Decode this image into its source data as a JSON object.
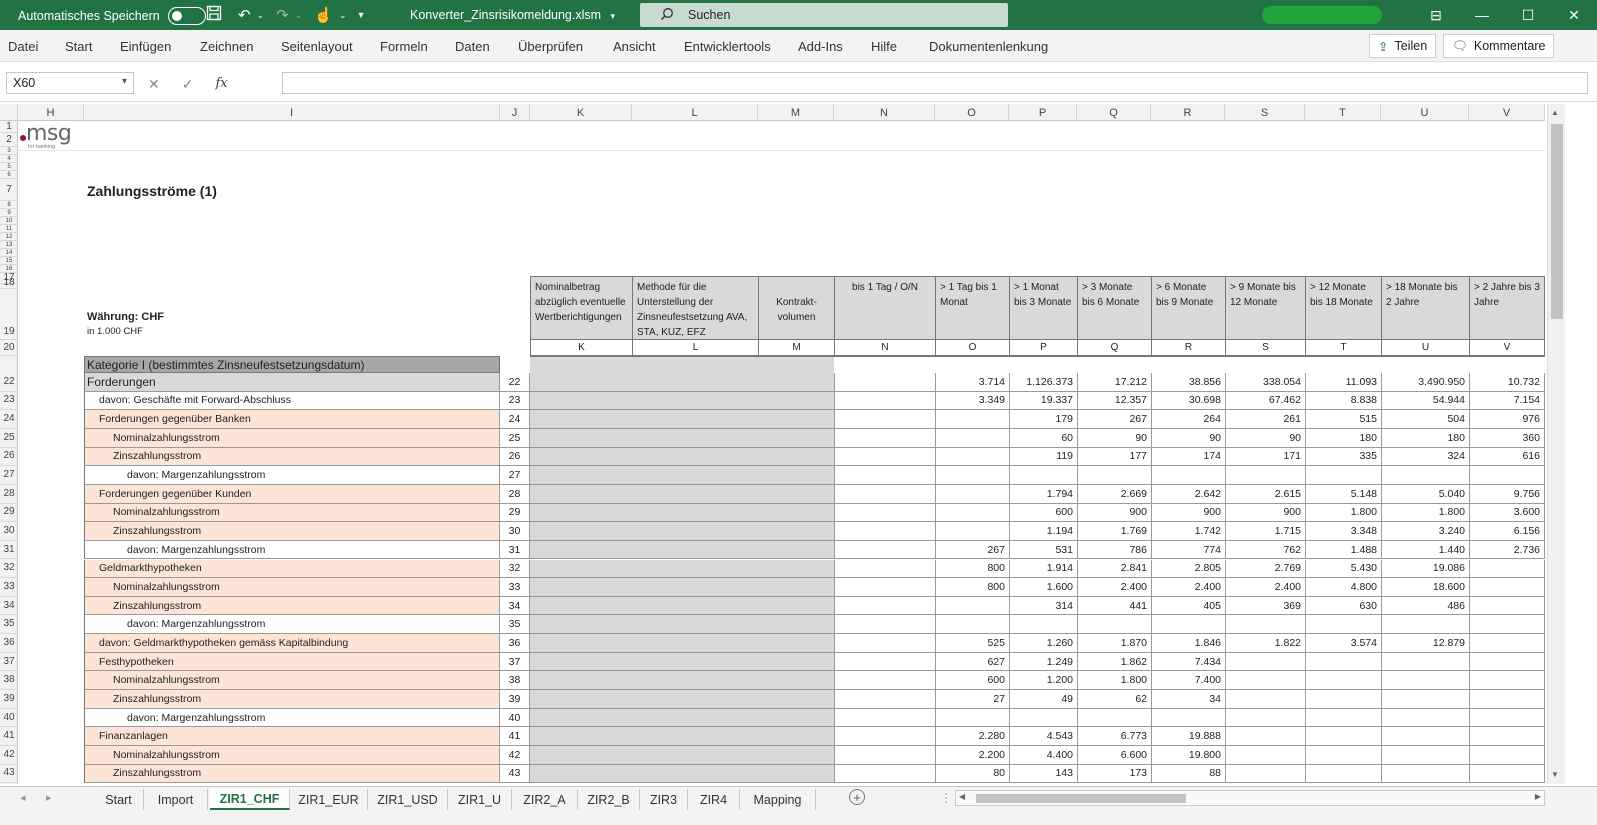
{
  "titlebar": {
    "autosave_label": "Automatisches Speichern",
    "filename": "Konverter_Zinsrisikomeldung.xlsm",
    "search_placeholder": "Suchen"
  },
  "ribbon": {
    "tabs": [
      "Datei",
      "Start",
      "Einfügen",
      "Zeichnen",
      "Seitenlayout",
      "Formeln",
      "Daten",
      "Überprüfen",
      "Ansicht",
      "Entwicklertools",
      "Add-Ins",
      "Hilfe",
      "Dokumentenlenkung"
    ],
    "share_label": "Teilen",
    "comments_label": "Kommentare"
  },
  "formula_bar": {
    "name_box": "X60",
    "fx": "fx",
    "content": ""
  },
  "columns": [
    "H",
    "I",
    "J",
    "K",
    "L",
    "M",
    "N",
    "O",
    "P",
    "Q",
    "R",
    "S",
    "T",
    "U",
    "V"
  ],
  "rows_top": [
    "1",
    "2",
    "3",
    "4",
    "5",
    "6",
    "7",
    "8",
    "9",
    "10",
    "11",
    "12",
    "13",
    "14",
    "15",
    "16",
    "17",
    "18",
    "19",
    "20"
  ],
  "sheet": {
    "logo_text": "msg",
    "logo_sub": "for banking",
    "title": "Zahlungsströme (1)",
    "currency": "Währung: CHF",
    "unit": "in 1.000 CHF",
    "headers": [
      "Nominalbetrag abzüglich eventuelle Wertberichtigungen",
      "Methode für die Unterstellung der Zinsneufestsetzung AVA, STA, KUZ, EFZ",
      "Kontrakt-volumen",
      "bis 1 Tag / O/N",
      "> 1 Tag bis 1 Monat",
      "> 1 Monat bis 3 Monate",
      "> 3 Monate bis 6 Monate",
      "> 6 Monate bis 9 Monate",
      "> 9 Monate bis 12 Monate",
      "> 12 Monate bis 18 Monate",
      "> 18 Monate bis 2 Jahre",
      "> 2 Jahre bis 3 Jahre"
    ],
    "header_letters": [
      "K",
      "L",
      "M",
      "N",
      "O",
      "P",
      "Q",
      "R",
      "S",
      "T",
      "U",
      "V"
    ],
    "category_label": "Kategorie I (bestimmtes Zinsneufestsetzungsdatum)",
    "rows": [
      {
        "r": "22",
        "label": "Forderungen",
        "nr": "22",
        "O": "3.714",
        "P": "1.126.373",
        "Q": "17.212",
        "R": "38.856",
        "S": "338.054",
        "T": "11.093",
        "U": "3.490.950",
        "V": "10.732"
      },
      {
        "r": "23",
        "label": "davon: Geschäfte mit Forward-Abschluss",
        "nr": "23",
        "O": "3.349",
        "P": "19.337",
        "Q": "12.357",
        "R": "30.698",
        "S": "67.462",
        "T": "8.838",
        "U": "54.944",
        "V": "7.154"
      },
      {
        "r": "24",
        "label": "Forderungen gegenüber Banken",
        "nr": "24",
        "O": "",
        "P": "179",
        "Q": "267",
        "R": "264",
        "S": "261",
        "T": "515",
        "U": "504",
        "V": "976"
      },
      {
        "r": "25",
        "label": "Nominalzahlungsstrom",
        "nr": "25",
        "O": "",
        "P": "60",
        "Q": "90",
        "R": "90",
        "S": "90",
        "T": "180",
        "U": "180",
        "V": "360"
      },
      {
        "r": "26",
        "label": "Zinszahlungsstrom",
        "nr": "26",
        "O": "",
        "P": "119",
        "Q": "177",
        "R": "174",
        "S": "171",
        "T": "335",
        "U": "324",
        "V": "616"
      },
      {
        "r": "27",
        "label": "davon: Margenzahlungsstrom",
        "nr": "27",
        "O": "",
        "P": "",
        "Q": "",
        "R": "",
        "S": "",
        "T": "",
        "U": "",
        "V": ""
      },
      {
        "r": "28",
        "label": "Forderungen gegenüber Kunden",
        "nr": "28",
        "O": "",
        "P": "1.794",
        "Q": "2.669",
        "R": "2.642",
        "S": "2.615",
        "T": "5.148",
        "U": "5.040",
        "V": "9.756"
      },
      {
        "r": "29",
        "label": "Nominalzahlungsstrom",
        "nr": "29",
        "O": "",
        "P": "600",
        "Q": "900",
        "R": "900",
        "S": "900",
        "T": "1.800",
        "U": "1.800",
        "V": "3.600"
      },
      {
        "r": "30",
        "label": "Zinszahlungsstrom",
        "nr": "30",
        "O": "",
        "P": "1.194",
        "Q": "1.769",
        "R": "1.742",
        "S": "1.715",
        "T": "3.348",
        "U": "3.240",
        "V": "6.156"
      },
      {
        "r": "31",
        "label": "davon: Margenzahlungsstrom",
        "nr": "31",
        "O": "267",
        "P": "531",
        "Q": "786",
        "R": "774",
        "S": "762",
        "T": "1.488",
        "U": "1.440",
        "V": "2.736"
      },
      {
        "r": "32",
        "label": "Geldmarkthypotheken",
        "nr": "32",
        "O": "800",
        "P": "1.914",
        "Q": "2.841",
        "R": "2.805",
        "S": "2.769",
        "T": "5.430",
        "U": "19.086",
        "V": ""
      },
      {
        "r": "33",
        "label": "Nominalzahlungsstrom",
        "nr": "33",
        "O": "800",
        "P": "1.600",
        "Q": "2.400",
        "R": "2.400",
        "S": "2.400",
        "T": "4.800",
        "U": "18.600",
        "V": ""
      },
      {
        "r": "34",
        "label": "Zinszahlungsstrom",
        "nr": "34",
        "O": "",
        "P": "314",
        "Q": "441",
        "R": "405",
        "S": "369",
        "T": "630",
        "U": "486",
        "V": ""
      },
      {
        "r": "35",
        "label": "davon: Margenzahlungsstrom",
        "nr": "35",
        "O": "",
        "P": "",
        "Q": "",
        "R": "",
        "S": "",
        "T": "",
        "U": "",
        "V": ""
      },
      {
        "r": "36",
        "label": "davon: Geldmarkthypotheken gemäss Kapitalbindung",
        "nr": "36",
        "O": "525",
        "P": "1.260",
        "Q": "1.870",
        "R": "1.846",
        "S": "1.822",
        "T": "3.574",
        "U": "12.879",
        "V": ""
      },
      {
        "r": "37",
        "label": "Festhypotheken",
        "nr": "37",
        "O": "627",
        "P": "1.249",
        "Q": "1.862",
        "R": "7.434",
        "S": "",
        "T": "",
        "U": "",
        "V": ""
      },
      {
        "r": "38",
        "label": "Nominalzahlungsstrom",
        "nr": "38",
        "O": "600",
        "P": "1.200",
        "Q": "1.800",
        "R": "7.400",
        "S": "",
        "T": "",
        "U": "",
        "V": ""
      },
      {
        "r": "39",
        "label": "Zinszahlungsstrom",
        "nr": "39",
        "O": "27",
        "P": "49",
        "Q": "62",
        "R": "34",
        "S": "",
        "T": "",
        "U": "",
        "V": ""
      },
      {
        "r": "40",
        "label": "davon: Margenzahlungsstrom",
        "nr": "40",
        "O": "",
        "P": "",
        "Q": "",
        "R": "",
        "S": "",
        "T": "",
        "U": "",
        "V": ""
      },
      {
        "r": "41",
        "label": "Finanzanlagen",
        "nr": "41",
        "O": "2.280",
        "P": "4.543",
        "Q": "6.773",
        "R": "19.888",
        "S": "",
        "T": "",
        "U": "",
        "V": ""
      },
      {
        "r": "42",
        "label": "Nominalzahlungsstrom",
        "nr": "42",
        "O": "2.200",
        "P": "4.400",
        "Q": "6.600",
        "R": "19.800",
        "S": "",
        "T": "",
        "U": "",
        "V": ""
      },
      {
        "r": "43",
        "label": "Zinszahlungsstrom",
        "nr": "43",
        "O": "80",
        "P": "143",
        "Q": "173",
        "R": "88",
        "S": "",
        "T": "",
        "U": "",
        "V": ""
      }
    ]
  },
  "sheet_tabs": [
    "Start",
    "Import",
    "ZIR1_CHF",
    "ZIR1_EUR",
    "ZIR1_USD",
    "ZIR1_U",
    "ZIR2_A",
    "ZIR2_B",
    "ZIR3",
    "ZIR4",
    "Mapping"
  ],
  "active_sheet": "ZIR1_CHF",
  "colors": {
    "excel_green": "#217346",
    "category_gray": "#a6a6a6",
    "label_peach": "#fce4d6",
    "header_gray": "#d9d9d9"
  }
}
